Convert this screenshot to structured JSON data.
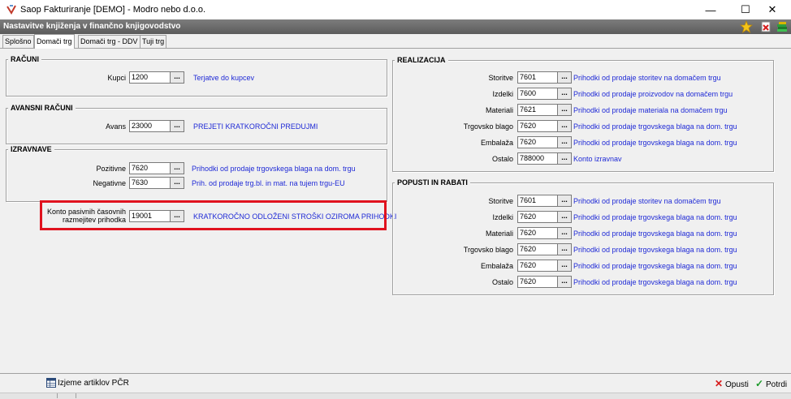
{
  "window": {
    "title": "Saop Fakturiranje [DEMO] - Modro nebo d.o.o.",
    "minimize_glyph": "—",
    "maximize_glyph": "☐",
    "close_glyph": "✕"
  },
  "header": {
    "title": "Nastavitve knjiženja v finančno knjigovodstvo",
    "icons": [
      "star-icon",
      "delete-document-icon",
      "books-icon"
    ]
  },
  "tabs": [
    {
      "label": "Splošno",
      "active": false
    },
    {
      "label": "Domači trg",
      "active": true
    },
    {
      "label": "Domači trg - DDV",
      "active": false
    },
    {
      "label": "Tuji trg",
      "active": false
    }
  ],
  "lookup_glyph": "...",
  "racuni": {
    "legend": "RAČUNI",
    "rows": [
      {
        "label": "Kupci",
        "value": "1200",
        "desc": "Terjatve do kupcev"
      }
    ]
  },
  "avansni": {
    "legend": "AVANSNI RAČUNI",
    "rows": [
      {
        "label": "Avans",
        "value": "23000",
        "desc": "PREJETI KRATKOROČNI PREDUJMI"
      }
    ]
  },
  "izravnave": {
    "legend": "IZRAVNAVE",
    "rows": [
      {
        "label": "Pozitivne",
        "value": "7620",
        "desc": "Prihodki od prodaje trgovskega blaga na dom. trgu"
      },
      {
        "label": "Negativne",
        "value": "7630",
        "desc": "Prih. od prodaje trg.bl. in mat. na tujem trgu-EU"
      }
    ]
  },
  "konto_pasivnih": {
    "label_line1": "Konto pasivnih časovnih",
    "label_line2": "razmejitev prihodka",
    "value": "19001",
    "desc": "KRATKOROČNO ODLOŽENI STROŠKI OZIROMA PRIHODKI"
  },
  "realizacija": {
    "legend": "REALIZACIJA",
    "rows": [
      {
        "label": "Storitve",
        "value": "7601",
        "desc": "Prihodki od prodaje storitev na domačem trgu"
      },
      {
        "label": "Izdelki",
        "value": "7600",
        "desc": "Prihodki od prodaje proizvodov na domačem trgu"
      },
      {
        "label": "Materiali",
        "value": "7621",
        "desc": "Prihodki od prodaje materiala na domačem trgu"
      },
      {
        "label": "Trgovsko blago",
        "value": "7620",
        "desc": "Prihodki od prodaje trgovskega blaga na dom. trgu"
      },
      {
        "label": "Embalaža",
        "value": "7620",
        "desc": "Prihodki od prodaje trgovskega blaga na dom. trgu"
      },
      {
        "label": "Ostalo",
        "value": "788000",
        "desc": "Konto izravnav"
      }
    ]
  },
  "popusti": {
    "legend": "POPUSTI IN RABATI",
    "rows": [
      {
        "label": "Storitve",
        "value": "7601",
        "desc": "Prihodki od prodaje storitev na domačem trgu"
      },
      {
        "label": "Izdelki",
        "value": "7620",
        "desc": "Prihodki od prodaje trgovskega blaga na dom. trgu"
      },
      {
        "label": "Materiali",
        "value": "7620",
        "desc": "Prihodki od prodaje trgovskega blaga na dom. trgu"
      },
      {
        "label": "Trgovsko blago",
        "value": "7620",
        "desc": "Prihodki od prodaje trgovskega blaga na dom. trgu"
      },
      {
        "label": "Embalaža",
        "value": "7620",
        "desc": "Prihodki od prodaje trgovskega blaga na dom. trgu"
      },
      {
        "label": "Ostalo",
        "value": "7620",
        "desc": "Prihodki od prodaje trgovskega blaga na dom. trgu"
      }
    ]
  },
  "bottom": {
    "izjeme_label": "Izjeme artiklov PČR",
    "opusti_label": "Opusti",
    "potrdi_label": "Potrdi",
    "opusti_glyph": "✕",
    "potrdi_glyph": "✓"
  },
  "colors": {
    "link_blue": "#1f2ad6",
    "highlight_red": "#e0121e",
    "header_gray": "#6b6b6b"
  }
}
